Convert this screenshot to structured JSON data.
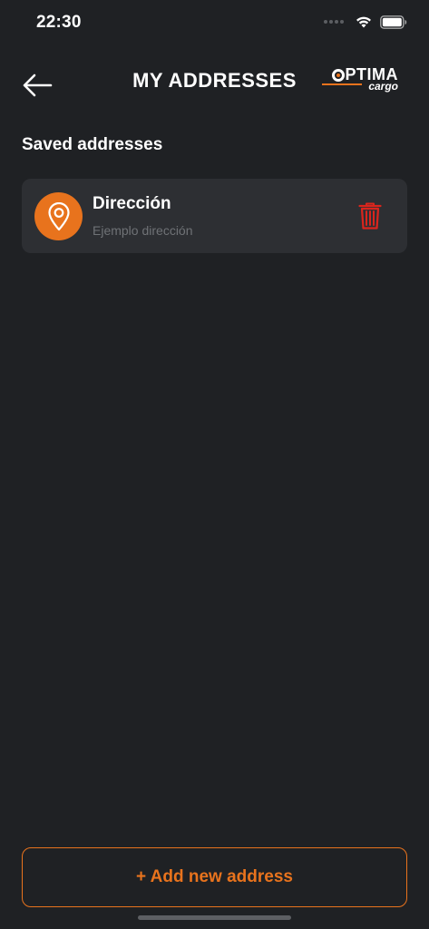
{
  "status_bar": {
    "time": "22:30"
  },
  "header": {
    "title": "MY ADDRESSES",
    "logo": {
      "brand": "OPTIMA",
      "brand_rest": "PTIMA",
      "sub": "cargo"
    }
  },
  "saved": {
    "section_title": "Saved addresses",
    "items": [
      {
        "name": "Dirección",
        "detail": "Ejemplo dirección"
      }
    ]
  },
  "actions": {
    "add_label": "+ Add new address"
  },
  "colors": {
    "background": "#1f2124",
    "card": "#2d2f33",
    "accent": "#e8731d",
    "delete": "#d9251d",
    "muted_text": "#6f7276"
  },
  "icons": {
    "back": "arrow-left-icon",
    "pin": "location-pin-icon",
    "delete": "trash-icon",
    "wifi": "wifi-icon",
    "battery": "battery-icon"
  }
}
